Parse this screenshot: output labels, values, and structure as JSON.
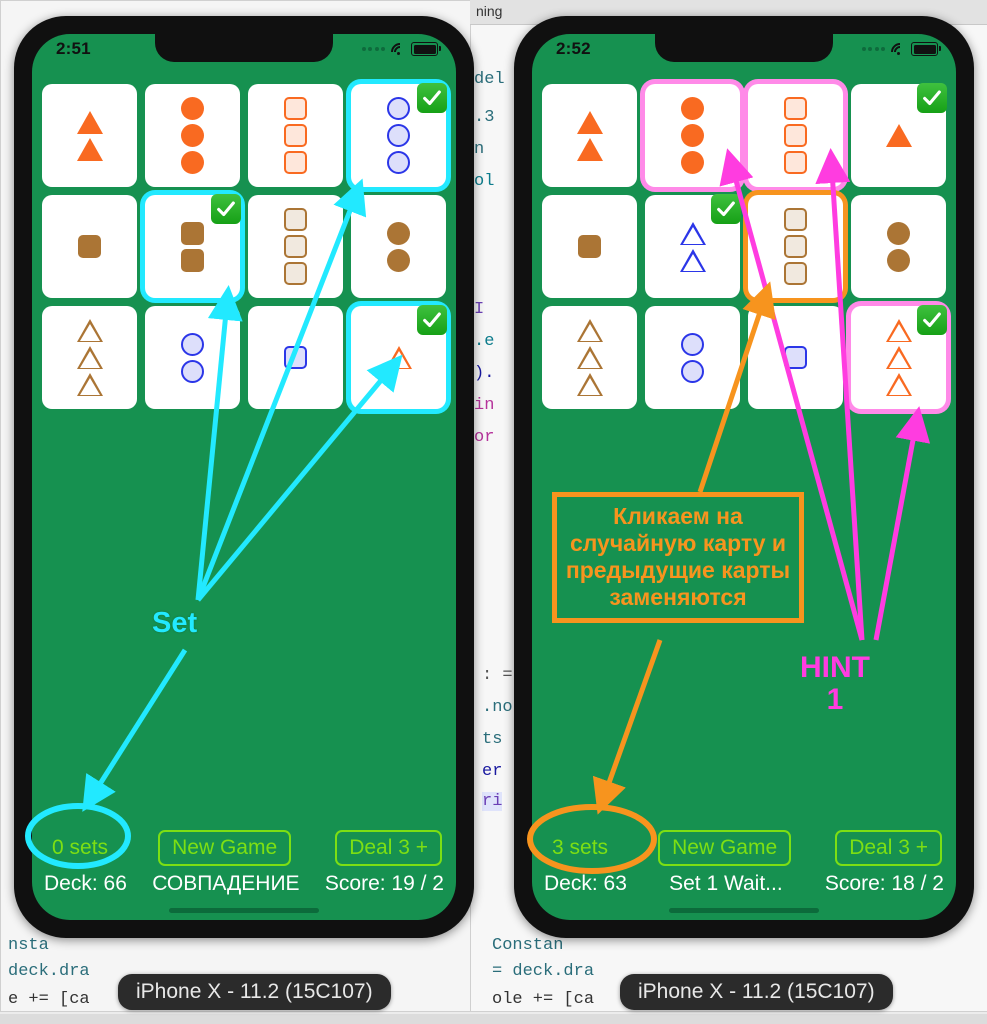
{
  "background": {
    "tab_label": "ning",
    "code_lines_right_edge": [
      "del",
      ".3",
      "n",
      "ol",
      "I",
      ".e",
      ").",
      "in",
      "or"
    ],
    "code_lines_mid": [
      ": =",
      ".no",
      "ts",
      "er",
      "ri"
    ],
    "code_bottom_left": [
      "nsta",
      "deck.dra",
      "e += [ca"
    ],
    "code_bottom_right": [
      "Constan",
      "= deck.dra",
      "ole += [ca"
    ]
  },
  "phones": [
    {
      "id": "left",
      "device_label": "iPhone X - 11.2 (15C107)",
      "status": {
        "time": "2:51"
      },
      "cards": [
        {
          "count": 2,
          "shape": "triangle",
          "fill": "solid",
          "color": "#f96a21",
          "selected": false,
          "checked": false,
          "highlight": "none"
        },
        {
          "count": 3,
          "shape": "circle",
          "fill": "solid",
          "color": "#f96a21",
          "selected": false,
          "checked": false,
          "highlight": "none"
        },
        {
          "count": 3,
          "shape": "square",
          "fill": "shaded",
          "color": "#f96a21",
          "selected": false,
          "checked": false,
          "highlight": "none"
        },
        {
          "count": 3,
          "shape": "circle",
          "fill": "shaded",
          "color": "#2b36e8",
          "selected": true,
          "checked": true,
          "highlight": "cyan"
        },
        {
          "count": 1,
          "shape": "square",
          "fill": "solid",
          "color": "#ab7535",
          "selected": false,
          "checked": false,
          "highlight": "none"
        },
        {
          "count": 2,
          "shape": "square",
          "fill": "solid",
          "color": "#ab7535",
          "selected": true,
          "checked": true,
          "highlight": "cyan"
        },
        {
          "count": 3,
          "shape": "square",
          "fill": "shaded",
          "color": "#ab7535",
          "selected": false,
          "checked": false,
          "highlight": "none"
        },
        {
          "count": 2,
          "shape": "circle",
          "fill": "solid",
          "color": "#ab7535",
          "selected": false,
          "checked": false,
          "highlight": "none"
        },
        {
          "count": 3,
          "shape": "triangle",
          "fill": "open",
          "color": "#ab7535",
          "selected": false,
          "checked": false,
          "highlight": "none"
        },
        {
          "count": 2,
          "shape": "circle",
          "fill": "shaded",
          "color": "#2b36e8",
          "selected": false,
          "checked": false,
          "highlight": "none"
        },
        {
          "count": 1,
          "shape": "square",
          "fill": "shaded",
          "color": "#2b36e8",
          "selected": false,
          "checked": false,
          "highlight": "none"
        },
        {
          "count": 1,
          "shape": "triangle",
          "fill": "open",
          "color": "#f96a21",
          "selected": true,
          "checked": true,
          "highlight": "cyan"
        }
      ],
      "controls": {
        "sets_label": "0 sets",
        "new_game_label": "New Game",
        "deal_label": "Deal 3 +"
      },
      "status_row": {
        "deck": "Deck: 66",
        "state": "СОВПАДЕНИЕ",
        "score": "Score: 19 / 2"
      }
    },
    {
      "id": "right",
      "device_label": "iPhone X - 11.2 (15C107)",
      "status": {
        "time": "2:52"
      },
      "cards": [
        {
          "count": 2,
          "shape": "triangle",
          "fill": "solid",
          "color": "#f96a21",
          "selected": false,
          "checked": false,
          "highlight": "none"
        },
        {
          "count": 3,
          "shape": "circle",
          "fill": "solid",
          "color": "#f96a21",
          "selected": true,
          "checked": false,
          "highlight": "pink"
        },
        {
          "count": 3,
          "shape": "square",
          "fill": "shaded",
          "color": "#f96a21",
          "selected": true,
          "checked": false,
          "highlight": "pink"
        },
        {
          "count": 1,
          "shape": "triangle",
          "fill": "solid",
          "color": "#f96a21",
          "selected": false,
          "checked": true,
          "highlight": "none"
        },
        {
          "count": 1,
          "shape": "square",
          "fill": "solid",
          "color": "#ab7535",
          "selected": false,
          "checked": false,
          "highlight": "none"
        },
        {
          "count": 2,
          "shape": "triangle",
          "fill": "open",
          "color": "#2b36e8",
          "selected": false,
          "checked": true,
          "highlight": "none"
        },
        {
          "count": 3,
          "shape": "square",
          "fill": "shaded",
          "color": "#ab7535",
          "selected": true,
          "checked": false,
          "highlight": "orange"
        },
        {
          "count": 2,
          "shape": "circle",
          "fill": "solid",
          "color": "#ab7535",
          "selected": false,
          "checked": false,
          "highlight": "none"
        },
        {
          "count": 3,
          "shape": "triangle",
          "fill": "open",
          "color": "#ab7535",
          "selected": false,
          "checked": false,
          "highlight": "none"
        },
        {
          "count": 2,
          "shape": "circle",
          "fill": "shaded",
          "color": "#2b36e8",
          "selected": false,
          "checked": false,
          "highlight": "none"
        },
        {
          "count": 1,
          "shape": "square",
          "fill": "shaded",
          "color": "#2b36e8",
          "selected": false,
          "checked": false,
          "highlight": "none"
        },
        {
          "count": 3,
          "shape": "triangle",
          "fill": "open",
          "color": "#f96a21",
          "selected": true,
          "checked": true,
          "highlight": "pink"
        }
      ],
      "controls": {
        "sets_label": "3 sets",
        "new_game_label": "New Game",
        "deal_label": "Deal 3 +"
      },
      "status_row": {
        "deck": "Deck: 63",
        "state": "Set 1 Wait...",
        "score": "Score: 18 / 2"
      }
    }
  ],
  "annotations": {
    "set_label": "Set",
    "hint_label": "HINT",
    "hint_number": "1",
    "orange_box_text": "Кликаем на случайную карту и предыдущие карты заменяются",
    "colors": {
      "cyan": "#22e9ff",
      "pink": "#ff3ce0",
      "orange": "#f7941e",
      "green_bg": "#169150",
      "button_green": "#7ddf13"
    }
  }
}
